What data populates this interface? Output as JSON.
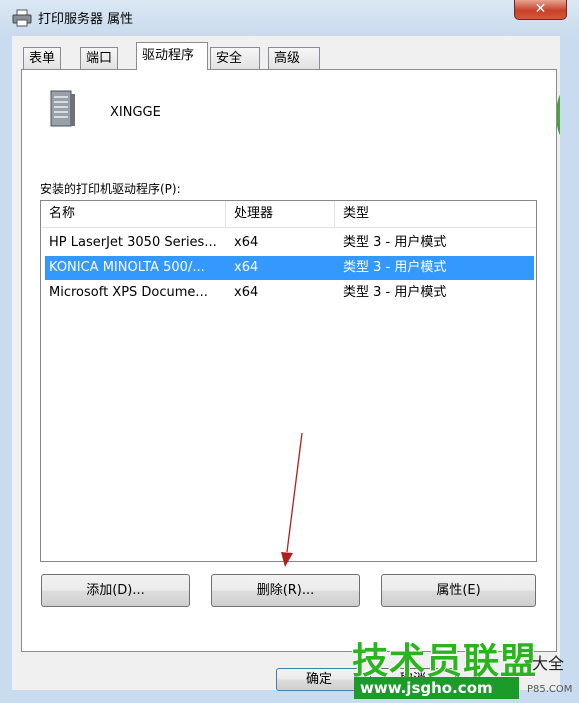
{
  "window": {
    "title": "打印服务器 属性",
    "close_label": "✕"
  },
  "tabs": [
    {
      "label": "表单"
    },
    {
      "label": "端口"
    },
    {
      "label": "驱动程序"
    },
    {
      "label": "安全"
    },
    {
      "label": "高级"
    }
  ],
  "active_tab": "驱动程序",
  "server": {
    "name": "XINGGE"
  },
  "drivers": {
    "caption": "安装的打印机驱动程序(P):",
    "columns": [
      "名称",
      "处理器",
      "类型"
    ],
    "rows": [
      {
        "name": "HP LaserJet 3050 Series...",
        "processor": "x64",
        "type": "类型 3 - 用户模式",
        "selected": false
      },
      {
        "name": "KONICA MINOLTA 500/...",
        "processor": "x64",
        "type": "类型 3 - 用户模式",
        "selected": true
      },
      {
        "name": "Microsoft XPS Docume...",
        "processor": "x64",
        "type": "类型 3 - 用户模式",
        "selected": false
      }
    ]
  },
  "buttons": {
    "add": "添加(D)...",
    "remove": "删除(R)...",
    "properties": "属性(E)"
  },
  "dialog_buttons": {
    "ok": "确定",
    "cancel": "取消"
  },
  "watermark": {
    "title": "技术员联盟",
    "suffix": "大全",
    "url": "www.jsgho.com",
    "small": "P85.COM"
  },
  "colors": {
    "selection": "#3399ff",
    "watermark_green": "#2ab51f",
    "arrow": "#b0211e"
  }
}
